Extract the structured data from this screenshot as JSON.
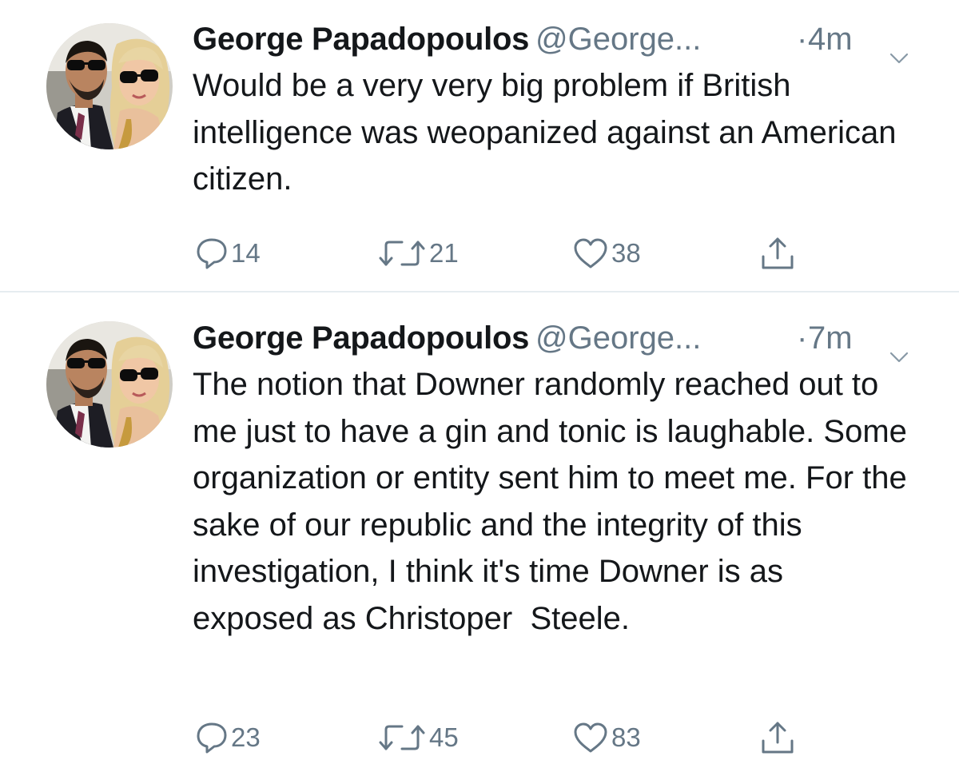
{
  "tweets": [
    {
      "author_name": "George Papadopoulos",
      "handle": "@George...",
      "separator": "·",
      "time": "4m",
      "text": "Would be a very very big problem if British intelligence was weopanized against an American citizen.",
      "replies": "14",
      "retweets": "21",
      "likes": "38"
    },
    {
      "author_name": "George Papadopoulos",
      "handle": "@George...",
      "separator": "·",
      "time": "7m",
      "text": "The notion that Downer randomly reached out to me just to have a gin and tonic is laughable. Some organization or entity sent him to meet me. For the sake of our republic and the integrity of this investigation, I think it's time Downer is as exposed as Christoper  Steele.",
      "replies": "23",
      "retweets": "45",
      "likes": "83"
    }
  ],
  "icons": {
    "reply": "reply-icon",
    "retweet": "retweet-icon",
    "like": "heart-icon",
    "share": "share-icon",
    "caret": "chevron-down-icon"
  },
  "colors": {
    "text": "#14171a",
    "secondary": "#657786",
    "divider": "#e6ecf0"
  }
}
